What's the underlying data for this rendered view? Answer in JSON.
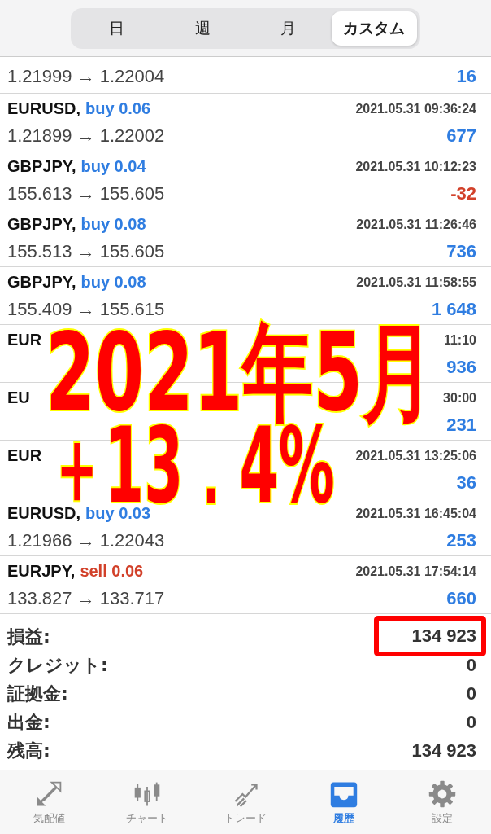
{
  "segments": [
    {
      "label": "日",
      "selected": false
    },
    {
      "label": "週",
      "selected": false
    },
    {
      "label": "月",
      "selected": false
    },
    {
      "label": "カスタム",
      "selected": true
    }
  ],
  "trades": [
    {
      "prices": [
        "1.21999 → 1.22004"
      ],
      "profit": "16",
      "negative": false
    },
    {
      "title": [
        {
          "text": "EURUSD,",
          "kind": "symbol"
        },
        {
          "text": "buy 0.06",
          "kind": "buy"
        }
      ],
      "time": [
        "2021.05.31 09:36:24"
      ],
      "prices": [
        "1.21899 → 1.22002"
      ],
      "profit": "677",
      "negative": false
    },
    {
      "title": [
        {
          "text": "GBPJPY,",
          "kind": "symbol"
        },
        {
          "text": "buy 0.04",
          "kind": "buy"
        }
      ],
      "time": [
        "2021.05.31 10:12:23"
      ],
      "prices": [
        "155.613 → 155.605"
      ],
      "profit": "-32",
      "negative": true
    },
    {
      "title": [
        {
          "text": "GBPJPY,",
          "kind": "symbol"
        },
        {
          "text": "buy 0.08",
          "kind": "buy"
        }
      ],
      "time": [
        "2021.05.31 11:26:46"
      ],
      "prices": [
        "155.513 → 155.605"
      ],
      "profit": "736",
      "negative": false
    },
    {
      "title": [
        {
          "text": "GBPJPY,",
          "kind": "symbol"
        },
        {
          "text": "buy 0.08",
          "kind": "buy"
        }
      ],
      "time": [
        "2021.05.31 11:58:55"
      ],
      "prices": [
        "155.409 → 155.615"
      ],
      "profit": "1 648",
      "negative": false
    },
    {
      "title": [
        {
          "text": "EUR",
          "kind": "symbol"
        }
      ],
      "time": [
        "11:10"
      ],
      "profit": "936",
      "negative": false
    },
    {
      "title": [
        {
          "text": "EU",
          "kind": "symbol"
        }
      ],
      "time": [
        "30:00"
      ],
      "profit": "231",
      "negative": false
    },
    {
      "title": [
        {
          "text": "EUR",
          "kind": "symbol"
        }
      ],
      "time": [
        "2021.05.31 13:25:06"
      ],
      "profit": "36",
      "negative": false
    },
    {
      "title": [
        {
          "text": "EURUSD,",
          "kind": "symbol"
        },
        {
          "text": "buy 0.03",
          "kind": "buy"
        }
      ],
      "time": [
        "2021.05.31 16:45:04"
      ],
      "prices": [
        "1.21966 → 1.22043"
      ],
      "profit": "253",
      "negative": false
    },
    {
      "title": [
        {
          "text": "EURJPY,",
          "kind": "symbol"
        },
        {
          "text": "sell 0.06",
          "kind": "sell"
        }
      ],
      "time": [
        "2021.05.31 17:54:14"
      ],
      "prices": [
        "133.827 → 133.717"
      ],
      "profit": "660",
      "negative": false
    }
  ],
  "overlay": {
    "lines": [
      "2021年5月",
      "＋13．4%"
    ]
  },
  "summary": [
    {
      "label": "損益:",
      "value": "134 923",
      "highlighted": true
    },
    {
      "label": "クレジット:",
      "value": "0",
      "highlighted": false
    },
    {
      "label": "証拠金:",
      "value": "0",
      "highlighted": false
    },
    {
      "label": "出金:",
      "value": "0",
      "highlighted": false
    },
    {
      "label": "残高:",
      "value": "134 923",
      "highlighted": false
    }
  ],
  "tabbar": [
    {
      "label": "気配値",
      "selected": false
    },
    {
      "label": "チャート",
      "selected": false
    },
    {
      "label": "トレード",
      "selected": false
    },
    {
      "label": "履歴",
      "selected": true
    },
    {
      "label": "設定",
      "selected": false
    }
  ]
}
